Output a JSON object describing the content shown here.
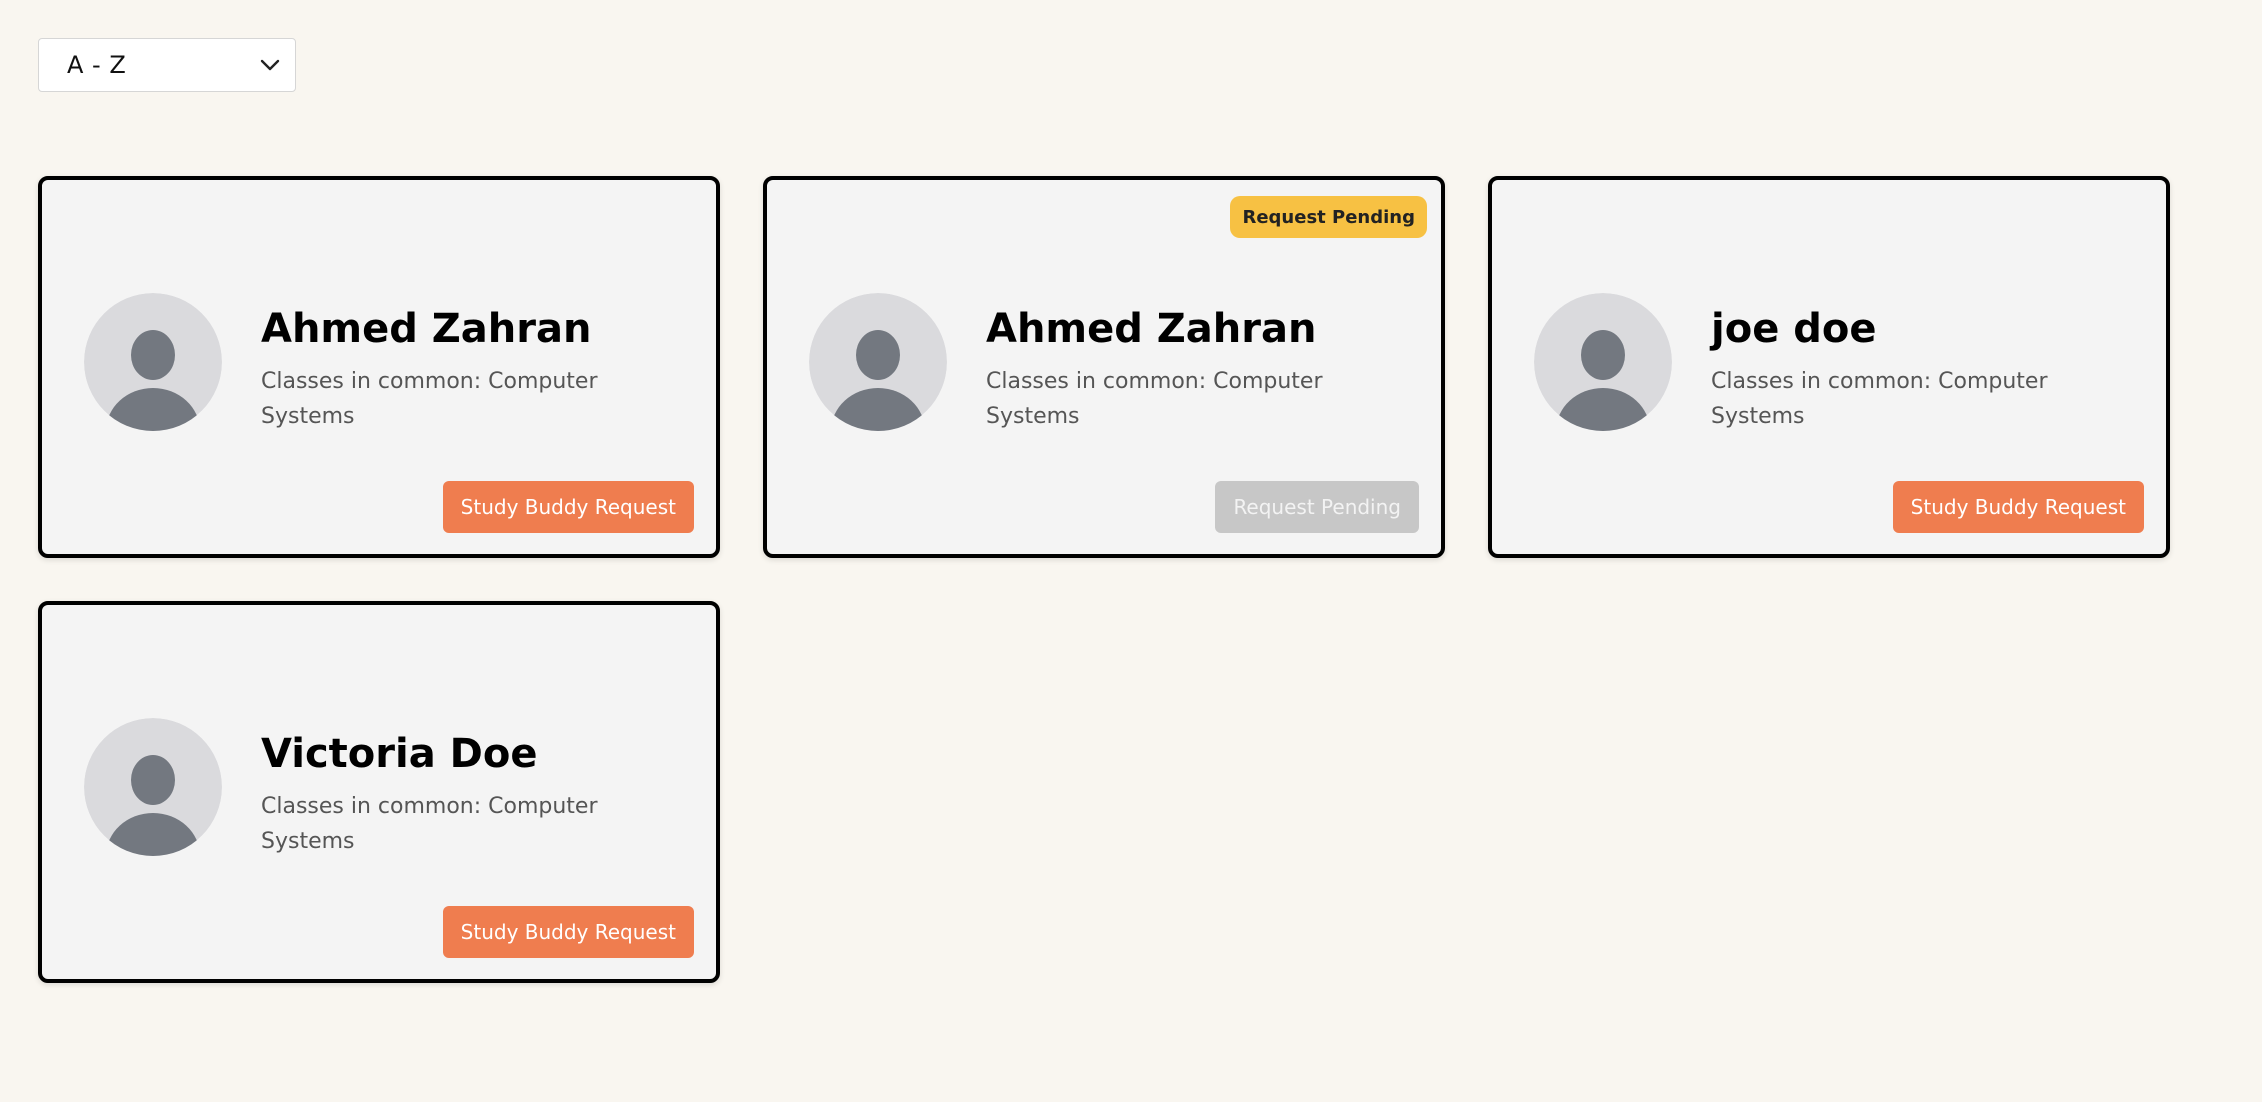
{
  "sort": {
    "selected": "A - Z"
  },
  "cards": [
    {
      "name": "Ahmed Zahran",
      "classes": "Classes in common: Computer Systems",
      "button": "Study Buddy Request",
      "status": "available"
    },
    {
      "name": "Ahmed Zahran",
      "classes": "Classes in common: Computer Systems",
      "button": "Request Pending",
      "status": "pending",
      "badge": "Request Pending"
    },
    {
      "name": "joe doe",
      "classes": "Classes in common: Computer Systems",
      "button": "Study Buddy Request",
      "status": "available"
    },
    {
      "name": "Victoria Doe",
      "classes": "Classes in common: Computer Systems",
      "button": "Study Buddy Request",
      "status": "available"
    }
  ],
  "colors": {
    "page_background": "#f9f6f0",
    "card_background": "#f4f4f4",
    "request_button": "#ef7d4f",
    "pending_button": "#c7c7c7",
    "pending_badge": "#f7c143"
  },
  "icons": {
    "avatar": "default-user-avatar-icon",
    "dropdown": "chevron-down-icon"
  }
}
